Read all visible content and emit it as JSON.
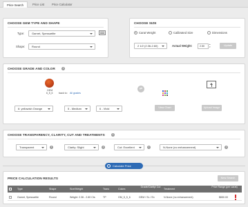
{
  "tabs": [
    "Price Search",
    "Price List",
    "Price Calculator"
  ],
  "gem": {
    "title": "CHOOSE GEM TYPE AND SHAPE",
    "type_label": "Type:",
    "type_value": "Garnet, Spessartite",
    "shape_label": "Shape:",
    "shape_value": "Round"
  },
  "size": {
    "title": "CHOOSE SIZE",
    "options": [
      "Carat Weight",
      "Calibrated Size",
      "Dimensions"
    ],
    "selected": "Carat Weight",
    "range_value": "2 1/2 (2.36-2.60)",
    "actual_weight_label": "Actual Weight:",
    "actual_weight_value": "2.50",
    "update_label": "Update"
  },
  "grade": {
    "title": "CHOOSE GRADE AND COLOR",
    "gem_name": "GEM",
    "gem_code": "6_5_6",
    "back_to": "back to:",
    "all_grades": "All grades",
    "hue_value": "6: yellowish Orange",
    "tone_value": "5 - Medium",
    "saturation_value": "6 - Vivid",
    "view_chart_label": "View Chart",
    "upload_image_label": "Upload Image",
    "color_swatch": "#c4451b"
  },
  "transparency": {
    "title": "CHOOSE TRANSPARENCY, CLARITY, CUT AND TREATMENTS",
    "transparency_value": "Transparent",
    "clarity_value": "Clarity: Slight",
    "cut_value": "Cut: Excellent",
    "treatment_value": "N-None (no enhancement)"
  },
  "calculate_label": "Calculate Price",
  "results": {
    "title": "PRICE CALCULATION RESULTS",
    "next_search_label": "New Search",
    "headers": [
      "Type",
      "Shape",
      "Size/Weight",
      "Trans",
      "Colors",
      "Grade/Clarity/ Cut",
      "Treatment",
      "Price Range (per carat)"
    ],
    "row": {
      "type": "Garnet, Spessartite",
      "shape": "Round",
      "size": "Weight: 2.36 - 2.60 Cts",
      "trans": "TP",
      "colors": "GM_5_5_6",
      "grade": "GEM / SL / Ex",
      "treatment": "N-None (no enhancement)",
      "price": "$650.00"
    }
  },
  "colors": {
    "accent": "#2e6bb5",
    "header_dark": "#6e6e6e",
    "gem": "#c4451b"
  }
}
